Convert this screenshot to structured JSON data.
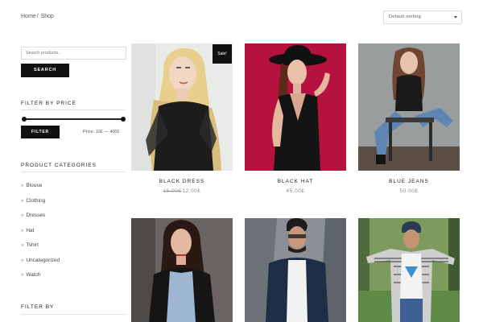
{
  "breadcrumb": {
    "home": "Home",
    "separator": "/",
    "current": "Shop"
  },
  "sort": {
    "selected": "Default sorting"
  },
  "search": {
    "placeholder": "Search products…",
    "button": "SEARCH"
  },
  "filter_price": {
    "title": "FILTER BY PRICE",
    "button": "FILTER",
    "price_label": "Price: 10£ — 400£",
    "range_min_fraction": 0.0,
    "range_max_fraction": 1.0
  },
  "categories": {
    "title": "PRODUCT CATEGORIES",
    "items": [
      "Blouse",
      "Clothing",
      "Dresses",
      "Hat",
      "Tshirt",
      "Uncategorized",
      "Watch"
    ]
  },
  "filter_by": {
    "title": "FILTER BY"
  },
  "products": [
    {
      "name": "BLACK DRESS",
      "old_price": "15.00£",
      "price": "12.00£",
      "badge": "Sale!"
    },
    {
      "name": "BLACK HAT",
      "price": "45.00£"
    },
    {
      "name": "BLUE JEANS",
      "price": "50.00£"
    }
  ],
  "colors": {
    "accent": "#111111",
    "hat_bg": "#b5123f",
    "price_text": "#888888"
  }
}
